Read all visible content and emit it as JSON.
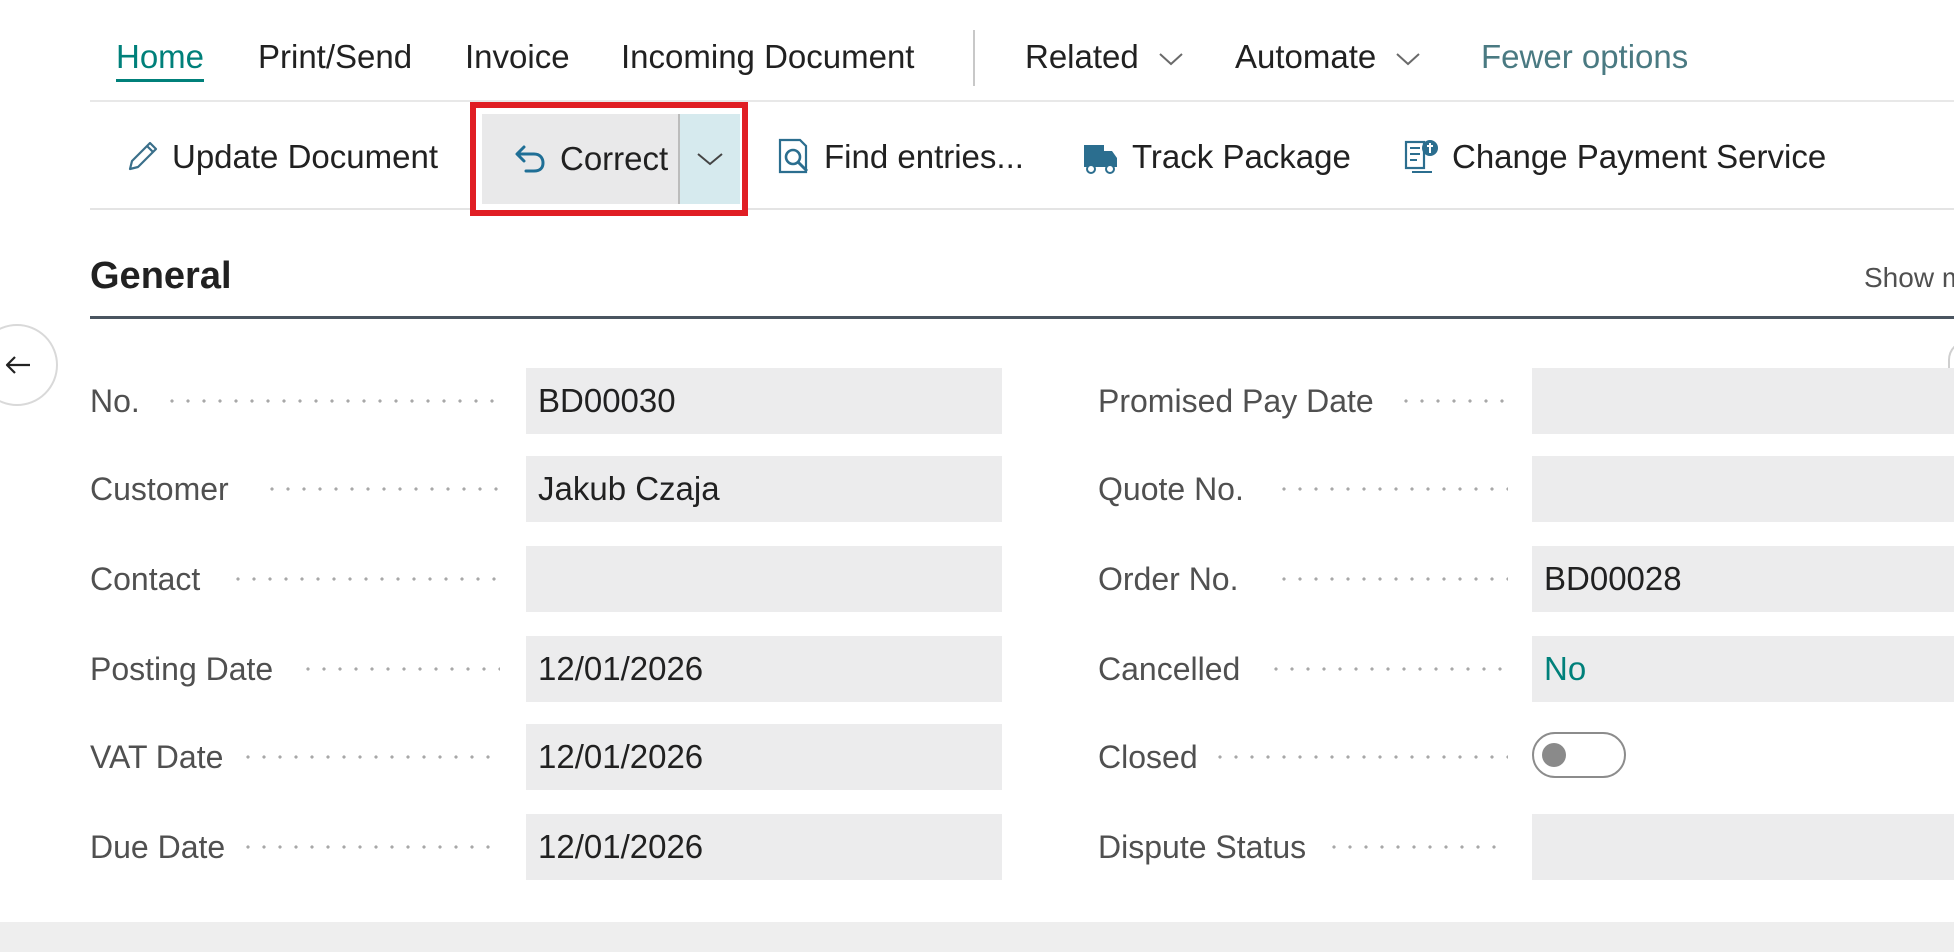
{
  "menu": {
    "home": "Home",
    "print_send": "Print/Send",
    "invoice": "Invoice",
    "incoming_document": "Incoming Document",
    "related": "Related",
    "automate": "Automate",
    "fewer_options": "Fewer options"
  },
  "actions": {
    "update_document": "Update Document",
    "correct": "Correct",
    "find_entries": "Find entries...",
    "track_package": "Track Package",
    "change_payment_service": "Change Payment Service"
  },
  "section": {
    "title": "General",
    "show_more": "Show m"
  },
  "fields_left": [
    {
      "label": "No.",
      "value": "BD00030"
    },
    {
      "label": "Customer",
      "value": "Jakub Czaja"
    },
    {
      "label": "Contact",
      "value": ""
    },
    {
      "label": "Posting Date",
      "value": "12/01/2026"
    },
    {
      "label": "VAT Date",
      "value": "12/01/2026"
    },
    {
      "label": "Due Date",
      "value": "12/01/2026"
    }
  ],
  "fields_right": [
    {
      "label": "Promised Pay Date",
      "value": ""
    },
    {
      "label": "Quote No.",
      "value": ""
    },
    {
      "label": "Order No.",
      "value": "BD00028"
    },
    {
      "label": "Cancelled",
      "value": "No"
    },
    {
      "label": "Closed",
      "value": "",
      "toggle_on": false
    },
    {
      "label": "Dispute Status",
      "value": ""
    }
  ],
  "colors": {
    "accent": "#00807a",
    "highlight_border": "#e01e24"
  }
}
